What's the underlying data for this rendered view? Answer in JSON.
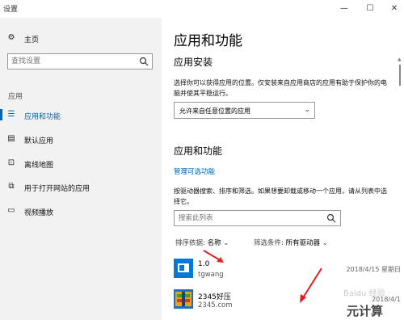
{
  "window": {
    "title": "设置",
    "minimize": "—",
    "maximize": "☐",
    "close": "✕"
  },
  "sidebar": {
    "home": "主页",
    "search_placeholder": "查找设置",
    "section": "应用",
    "items": [
      {
        "label": "应用和功能",
        "icon": "apps-list-icon",
        "active": true
      },
      {
        "label": "默认应用",
        "icon": "default-apps-icon",
        "active": false
      },
      {
        "label": "离线地图",
        "icon": "map-icon",
        "active": false
      },
      {
        "label": "用于打开网站的应用",
        "icon": "website-apps-icon",
        "active": false
      },
      {
        "label": "视频播放",
        "icon": "video-icon",
        "active": false
      }
    ]
  },
  "main": {
    "page_title": "应用和功能",
    "install_heading": "应用安装",
    "install_desc": "选择你可以获得应用的位置。仅安装来自应用商店的应用有助于保护你的电脑并使其平稳运行。",
    "install_select": "允许来自任意位置的应用",
    "features_heading": "应用和功能",
    "manage_link": "管理可选功能",
    "features_desc": "按驱动器搜索、排序和筛选。如果想要卸载或移动一个应用，请从列表中选择它。",
    "list_search_placeholder": "搜索此列表",
    "sort_label": "排序依据:",
    "sort_value": "名称",
    "filter_label": "筛选条件:",
    "filter_value": "所有驱动器",
    "apps": [
      {
        "name": "1.0",
        "publisher": "tgwang",
        "date": "2018/4/15 星期日"
      },
      {
        "name": "2345好压",
        "publisher": "2345.com",
        "date": "2018/4/1"
      }
    ]
  },
  "watermark": {
    "text": "Baidu 经验",
    "stamp": "元计算"
  },
  "colors": {
    "accent": "#0063b1",
    "sidebar_bg": "#f2f2f2",
    "arrow": "#e02020"
  }
}
